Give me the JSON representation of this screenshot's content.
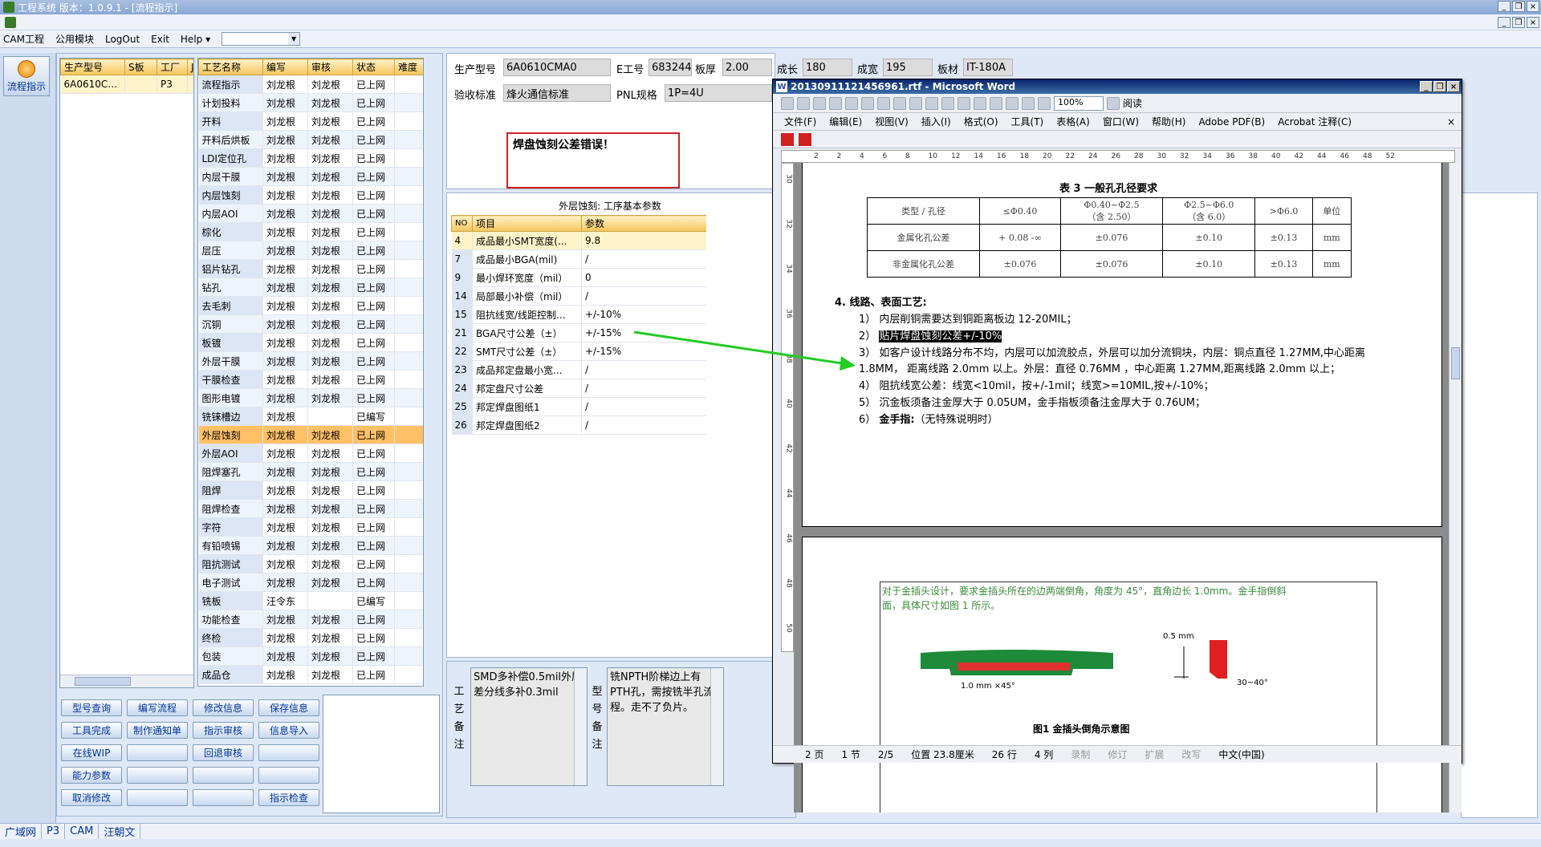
{
  "app": {
    "title": "工程系统    版本：1.0.9.1 - [流程指示]",
    "menu": [
      "CAM工程",
      "公用模块",
      "LogOut",
      "Exit",
      "Help"
    ],
    "menu_help_arrow": "▾",
    "menu_select_value": ""
  },
  "rail": {
    "button_label": "流程指示"
  },
  "model_grid": {
    "headers": [
      "生产型号",
      "S板",
      "工厂",
      "J"
    ],
    "rows": [
      [
        "6A0610CMA0",
        "",
        "P3",
        ""
      ]
    ]
  },
  "process_grid": {
    "headers": [
      "工艺名称",
      "编写",
      "审核",
      "状态",
      "难度"
    ],
    "rows": [
      [
        "流程指示",
        "刘龙根",
        "刘龙根",
        "已上网",
        ""
      ],
      [
        "计划投料",
        "刘龙根",
        "刘龙根",
        "已上网",
        ""
      ],
      [
        "开料",
        "刘龙根",
        "刘龙根",
        "已上网",
        ""
      ],
      [
        "开料后烘板",
        "刘龙根",
        "刘龙根",
        "已上网",
        ""
      ],
      [
        "LDI定位孔",
        "刘龙根",
        "刘龙根",
        "已上网",
        ""
      ],
      [
        "内层干膜",
        "刘龙根",
        "刘龙根",
        "已上网",
        ""
      ],
      [
        "内层蚀刻",
        "刘龙根",
        "刘龙根",
        "已上网",
        ""
      ],
      [
        "内层AOI",
        "刘龙根",
        "刘龙根",
        "已上网",
        ""
      ],
      [
        "棕化",
        "刘龙根",
        "刘龙根",
        "已上网",
        ""
      ],
      [
        "层压",
        "刘龙根",
        "刘龙根",
        "已上网",
        ""
      ],
      [
        "铝片钻孔",
        "刘龙根",
        "刘龙根",
        "已上网",
        ""
      ],
      [
        "钻孔",
        "刘龙根",
        "刘龙根",
        "已上网",
        ""
      ],
      [
        "去毛刺",
        "刘龙根",
        "刘龙根",
        "已上网",
        ""
      ],
      [
        "沉铜",
        "刘龙根",
        "刘龙根",
        "已上网",
        ""
      ],
      [
        "板镀",
        "刘龙根",
        "刘龙根",
        "已上网",
        ""
      ],
      [
        "外层干膜",
        "刘龙根",
        "刘龙根",
        "已上网",
        ""
      ],
      [
        "干膜检查",
        "刘龙根",
        "刘龙根",
        "已上网",
        ""
      ],
      [
        "图形电镀",
        "刘龙根",
        "刘龙根",
        "已上网",
        ""
      ],
      [
        "铣铼槽边",
        "刘龙根",
        "",
        "已编写",
        ""
      ],
      [
        "外层蚀刻",
        "刘龙根",
        "刘龙根",
        "已上网",
        ""
      ],
      [
        "外层AOI",
        "刘龙根",
        "刘龙根",
        "已上网",
        ""
      ],
      [
        "阻焊塞孔",
        "刘龙根",
        "刘龙根",
        "已上网",
        ""
      ],
      [
        "阻焊",
        "刘龙根",
        "刘龙根",
        "已上网",
        ""
      ],
      [
        "阻焊检查",
        "刘龙根",
        "刘龙根",
        "已上网",
        ""
      ],
      [
        "字符",
        "刘龙根",
        "刘龙根",
        "已上网",
        ""
      ],
      [
        "有铅喷锡",
        "刘龙根",
        "刘龙根",
        "已上网",
        ""
      ],
      [
        "阻抗测试",
        "刘龙根",
        "刘龙根",
        "已上网",
        ""
      ],
      [
        "电子测试",
        "刘龙根",
        "刘龙根",
        "已上网",
        ""
      ],
      [
        "铣板",
        "汪令东",
        "",
        "已编写",
        ""
      ],
      [
        "功能检查",
        "刘龙根",
        "刘龙根",
        "已上网",
        ""
      ],
      [
        "终检",
        "刘龙根",
        "刘龙根",
        "已上网",
        ""
      ],
      [
        "包装",
        "刘龙根",
        "刘龙根",
        "已上网",
        ""
      ],
      [
        "成品仓",
        "刘龙根",
        "刘龙根",
        "已上网",
        ""
      ]
    ],
    "selected_index": 19
  },
  "buttons": [
    [
      "型号查询",
      "编写流程",
      "修改信息",
      "保存信息"
    ],
    [
      "工具完成",
      "制作通知单",
      "指示审核",
      "信息导入"
    ],
    [
      "在线WIP",
      "",
      "回退审核",
      ""
    ],
    [
      "能力参数",
      "",
      "",
      ""
    ],
    [
      "取消修改",
      "",
      "",
      "指示检查"
    ]
  ],
  "header_form": {
    "model_label": "生产型号",
    "model_value": "6A0610CMA0",
    "e_label": "E工号",
    "e_value": "683244",
    "thick_label": "板厚",
    "thick_value": "2.00",
    "len_label": "成长",
    "len_value": "180",
    "width_label": "成宽",
    "width_value": "195",
    "mat_label": "板材",
    "mat_value": "IT-180A",
    "std_label": "验收标准",
    "std_value": "烽火通信标准",
    "pnl_label": "PNL规格",
    "pnl_value": "1P=4U"
  },
  "error_message": "焊盘蚀刻公差错误！",
  "param_grid": {
    "title": "外层蚀刻: 工序基本参数",
    "headers": [
      "NO",
      "项目",
      "参数"
    ],
    "rows": [
      [
        "4",
        "成品最小SMT宽度(...",
        "9.8"
      ],
      [
        "7",
        "成品最小BGA(mil)",
        "/"
      ],
      [
        "9",
        "最小焊环宽度（mil）",
        "0"
      ],
      [
        "14",
        "局部最小补偿（mil）",
        "/"
      ],
      [
        "15",
        "阻抗线宽/线距控制...",
        "+/-10%"
      ],
      [
        "21",
        "BGA尺寸公差（±）",
        "+/-15%"
      ],
      [
        "22",
        "SMT尺寸公差（±）",
        "+/-15%"
      ],
      [
        "23",
        "成品邦定盘最小宽...",
        "/"
      ],
      [
        "24",
        "邦定盘尺寸公差",
        "/"
      ],
      [
        "25",
        "邦定焊盘图纸1",
        "/"
      ],
      [
        "26",
        "邦定焊盘图纸2",
        "/"
      ]
    ]
  },
  "notes": {
    "process_label": "工艺备注",
    "process_text": "SMD多补偿0.5mil外层差分线多补0.3mil",
    "model_label": "型号备注",
    "model_text": "铣NPTH阶梯边上有PTH孔，需按铣半孔流程。走不了负片。"
  },
  "status_tabs": [
    "广域网",
    "P3",
    "CAM",
    "汪朝文"
  ],
  "word": {
    "title": "20130911121456961.rtf - Microsoft Word",
    "icon_letter": "W",
    "zoom": "100%",
    "reading_label": "阅读",
    "menu": [
      "文件(F)",
      "编辑(E)",
      "视图(V)",
      "插入(I)",
      "格式(O)",
      "工具(T)",
      "表格(A)",
      "窗口(W)",
      "帮助(H)",
      "Adobe PDF(B)",
      "Acrobat 注释(C)"
    ],
    "close_doc": "×",
    "ruler": [
      "2",
      "2",
      "4",
      "6",
      "8",
      "10",
      "12",
      "14",
      "16",
      "18",
      "20",
      "22",
      "24",
      "26",
      "28",
      "30",
      "32",
      "34",
      "36",
      "38",
      "40",
      "42",
      "44",
      "46",
      "48",
      "52"
    ],
    "vruler": [
      "30",
      "32",
      "34",
      "36",
      "38",
      "40",
      "42",
      "44",
      "46",
      "48",
      "50"
    ],
    "table_title": "表 3   一般孔孔径要求",
    "table": [
      [
        "类型 / 孔径",
        "≤Φ0.40",
        "Φ0.40~Φ2.5\n（含 2.50）",
        "Φ2.5~Φ6.0\n（含 6.0）",
        ">Φ6.0",
        "单位"
      ],
      [
        "金属化孔公差",
        "+ 0.08 -∞",
        "±0.076",
        "±0.10",
        "±0.13",
        "mm"
      ],
      [
        "非金属化孔公差",
        "±0.076",
        "±0.076",
        "±0.10",
        "±0.13",
        "mm"
      ]
    ],
    "section_title": "4.   线路、表面工艺:",
    "lines": [
      "1）  内层削铜需要达到铜距离板边 12-20MIL；",
      "2）",
      "3）  如客户设计线路分布不均，内层可以加流胶点，外层可以加分流铜块，内层：铜点直径 1.27MM,中心距离",
      "      1.8MM， 距离线路 2.0mm 以上。外层：直径 0.76MM ，中心距离 1.27MM,距离线路 2.0mm 以上；",
      "4）  阻抗线宽公差：线宽<10mil，按+/-1mil；线宽>=10MIL,按+/-10%；",
      "5）  沉金板须备注金厚大于 0.05UM，金手指板须备注金厚大于 0.76UM；",
      "6）"
    ],
    "highlight_line": "贴片焊盘蚀刻公差+/-10%",
    "line6_bold": "金手指:",
    "line6_rest": "（无特殊说明时）",
    "page2_text1": "对于金插头设计，要求金插头所在的边两端倒角，角度为 45°，直角边长 1.0mm。金手指倒斜",
    "page2_text2": "面，具体尺寸如图 1 所示。",
    "fig_label_05": "0.5 mm",
    "fig_label_10": "1.0 mm ×45°",
    "fig_label_ang": "30~40°",
    "fig_caption": "图1   金插头倒角示意图",
    "status": {
      "page": "2 页",
      "section": "1 节",
      "of": "2/5",
      "pos": "位置 23.8厘米",
      "row": "26 行",
      "col": "4 列",
      "rec": "录制",
      "rev": "修订",
      "ext": "扩展",
      "ovr": "改写",
      "lang": "中文(中国)"
    }
  },
  "colors": {
    "error": "#d02020",
    "arrow": "#22cc22",
    "selected_row": "#ffc066",
    "header_bg": "#f5c65c"
  }
}
